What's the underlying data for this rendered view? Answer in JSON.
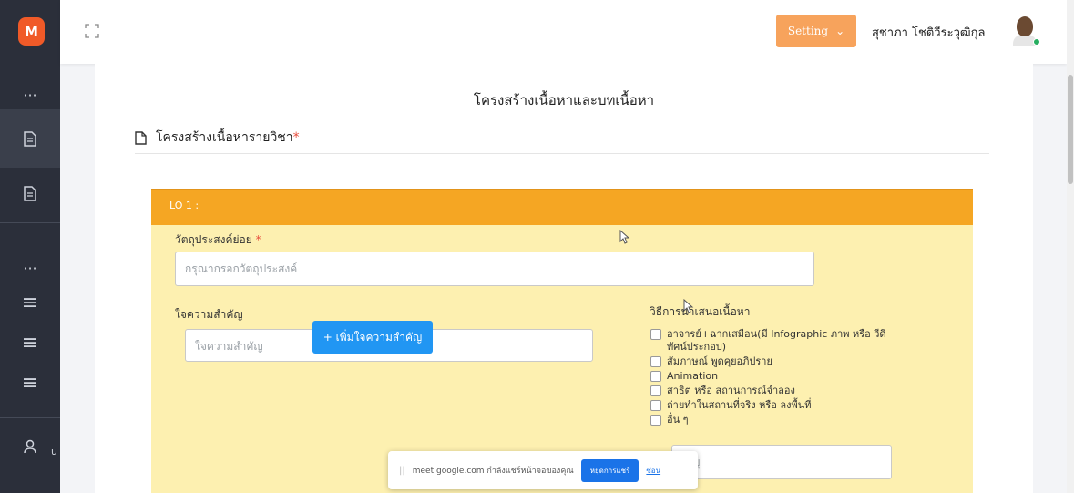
{
  "sidebar": {
    "logo": "M",
    "items": [
      {
        "icon": "ellipsis-icon",
        "glyph": "···"
      },
      {
        "icon": "document-icon",
        "glyph": "🗎"
      },
      {
        "icon": "document-icon",
        "glyph": "🗎"
      },
      {
        "icon": "ellipsis-icon",
        "glyph": "···"
      },
      {
        "icon": "menu-icon",
        "glyph": "≡"
      },
      {
        "icon": "menu-icon",
        "glyph": "≡"
      },
      {
        "icon": "menu-icon",
        "glyph": "≡"
      },
      {
        "icon": "user-icon",
        "glyph": "⚇"
      }
    ],
    "user_text_fragment": "u"
  },
  "topbar": {
    "setting_label": "Setting",
    "user_name": "สุชาภา โชติวีระวุฒิกุล"
  },
  "page": {
    "title": "โครงสร้างเนื้อหาและบทเนื้อหา",
    "section_title": "โครงสร้างเนื้อหารายวิชา",
    "required_mark": "*"
  },
  "lo": {
    "header": "LO 1 :",
    "objective_label": "วัตถุประสงค์ย่อย",
    "objective_required": "*",
    "objective_placeholder": "กรุณากรอกวัตถุประสงค์",
    "keypoint_label": "ใจความสำคัญ",
    "keypoint_placeholder": "ใจความสำคัญ",
    "add_keypoint_button": "+ เพิ่มใจความสำคัญ",
    "method_title": "วิธีการนำเสนอเนื้อหา",
    "methods": [
      "อาจารย์+ฉากเสมือน(มี Infographic ภาพ หรือ วีดิทัศน์ประกอบ)",
      "สัมภาษณ์ พูดคุยอภิปราย",
      "Animation",
      "สาธิต หรือ สถานการณ์จำลอง",
      "ถ่ายทำในสถานที่จริง หรือ ลงพื้นที่",
      "อื่น ๆ"
    ],
    "other_placeholder": "ระบุ"
  },
  "meet_bar": {
    "message": "meet.google.com กำลังแชร์หน้าจอของคุณ",
    "stop_label": "หยุดการแชร์",
    "hide_label": "ซ่อน"
  },
  "colors": {
    "sidebar_bg": "#2b2f3a",
    "logo_orange": "#f05a28",
    "setting_orange": "#f7a35c",
    "lo_header_orange": "#f5a623",
    "lo_body_yellow": "#fdf0b0",
    "add_button_blue": "#2196f3"
  }
}
